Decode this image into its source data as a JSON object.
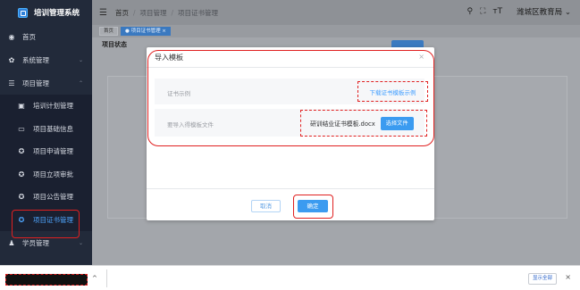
{
  "brand": {
    "title": "培训管理系统"
  },
  "sidebar": {
    "items": [
      {
        "label": "首页",
        "icon": "dashboard-icon",
        "glyph": "◉"
      },
      {
        "label": "系统管理",
        "icon": "gear-icon",
        "glyph": "✿",
        "arrow": "⌄"
      },
      {
        "label": "项目管理",
        "icon": "list-icon",
        "glyph": "☰",
        "arrow": "⌃"
      }
    ],
    "submenu": [
      {
        "label": "培训计划管理",
        "icon": "plan-icon",
        "glyph": "▣"
      },
      {
        "label": "项目基础信息",
        "icon": "monitor-icon",
        "glyph": "▭"
      },
      {
        "label": "项目申请管理",
        "icon": "circle-icon",
        "glyph": "✪"
      },
      {
        "label": "项目立项审批",
        "icon": "circle-icon",
        "glyph": "✪"
      },
      {
        "label": "项目公告管理",
        "icon": "circle-icon",
        "glyph": "✪"
      },
      {
        "label": "项目证书管理",
        "icon": "circle-icon",
        "glyph": "✪",
        "active": true
      }
    ],
    "after": [
      {
        "label": "学员管理",
        "icon": "user-icon",
        "glyph": "♟",
        "arrow": "⌄"
      }
    ]
  },
  "header": {
    "breadcrumb": [
      "首页",
      "项目管理",
      "项目证书管理"
    ],
    "user": "潍城区教育局",
    "icons": {
      "search": "🔍",
      "fullscreen": "⛶",
      "font": "T"
    }
  },
  "tags": [
    {
      "label": "首页",
      "active": false
    },
    {
      "label": "● 项目证书管理 ×",
      "active": true
    }
  ],
  "filter": {
    "label": "项目状态"
  },
  "dialog": {
    "title": "导入模板",
    "close": "×",
    "row1_label": "证书示例",
    "row1_link": "下载证书模板示例",
    "row2_label": "要导入得模板文件",
    "file_name": "研训结业证书模板.docx",
    "choose_btn": "选择文件",
    "cancel_btn": "取消",
    "ok_btn": "确定"
  },
  "bottom_bar": {
    "show_all": "显示全部",
    "close": "×",
    "chevron": "^"
  },
  "colors": {
    "accent": "#409eff",
    "sidebar_bg": "#222a3a",
    "annotation": "#e02020"
  }
}
